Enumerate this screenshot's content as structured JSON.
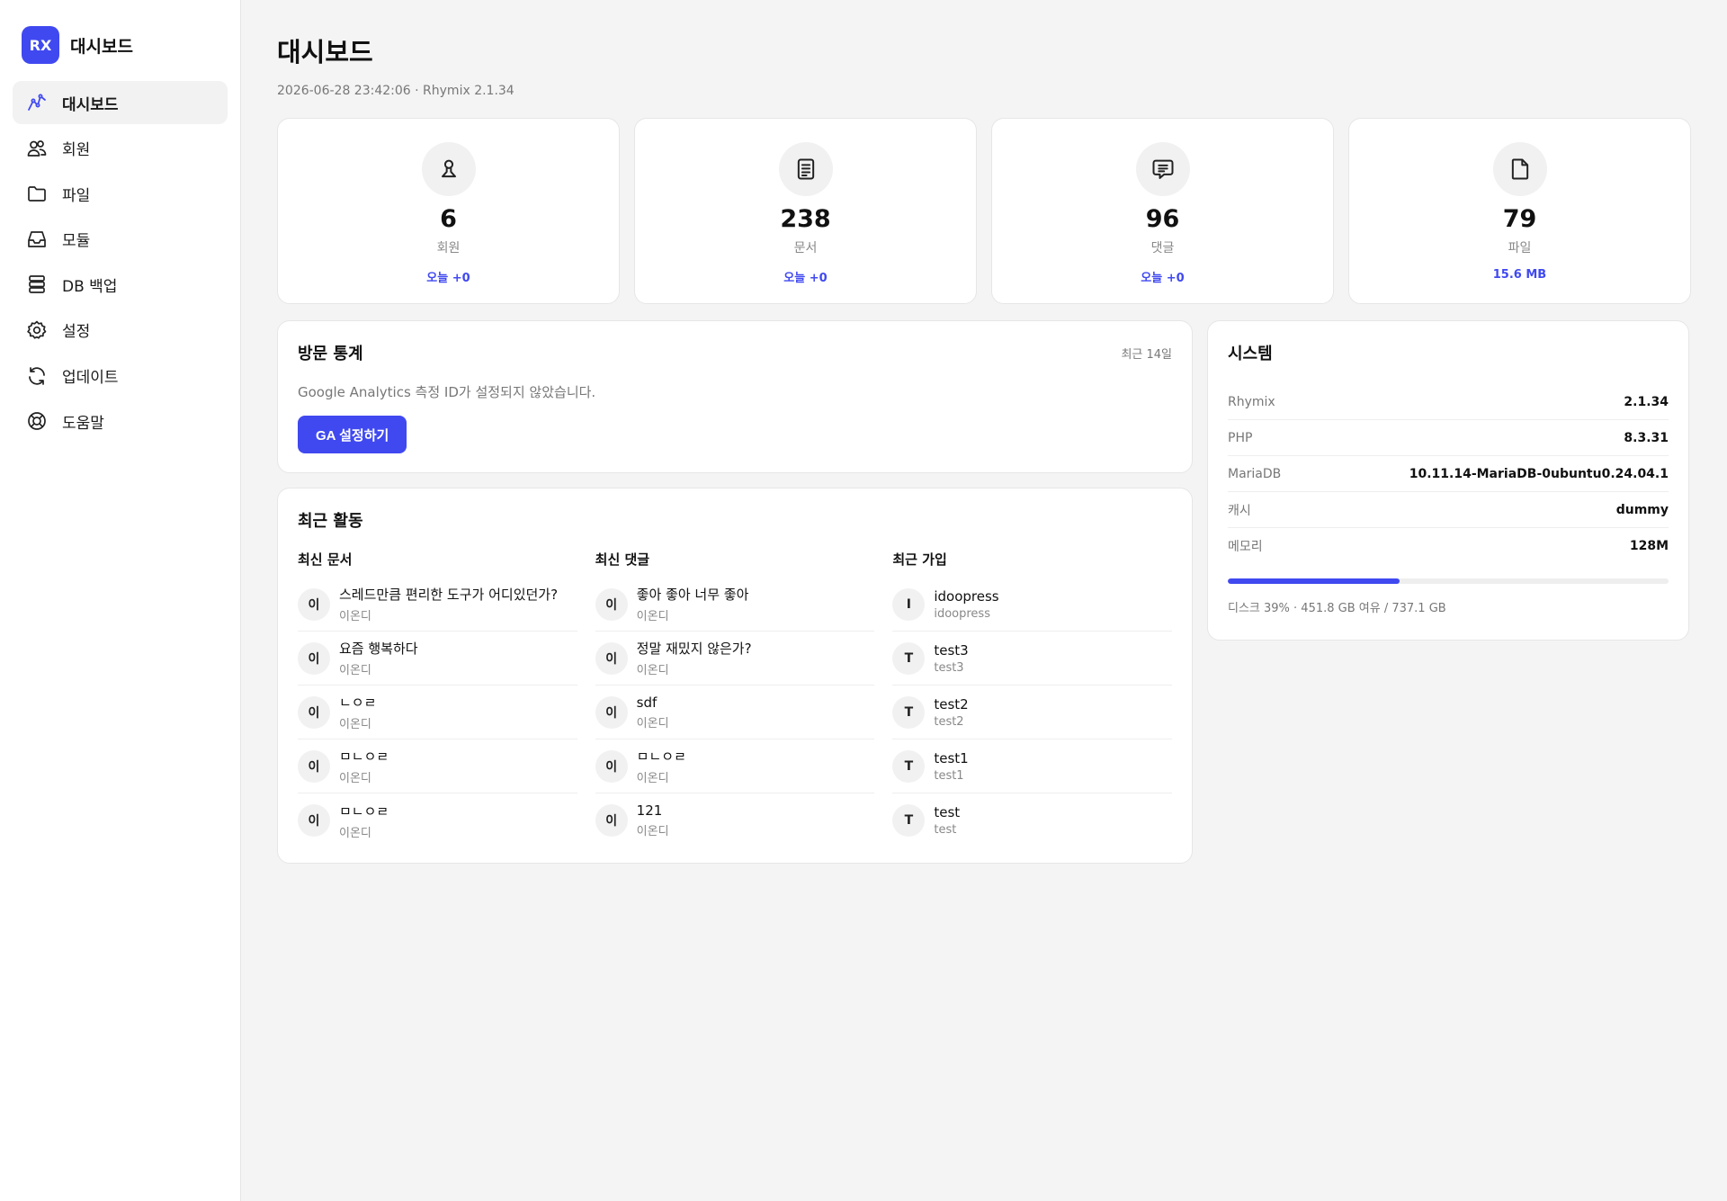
{
  "brand": {
    "logo_text": "RX",
    "name": "대시보드"
  },
  "sidebar": {
    "items": [
      {
        "label": "대시보드",
        "icon": "chart-line-icon",
        "active": true
      },
      {
        "label": "회원",
        "icon": "users-icon",
        "active": false
      },
      {
        "label": "파일",
        "icon": "folder-icon",
        "active": false
      },
      {
        "label": "모듈",
        "icon": "inbox-icon",
        "active": false
      },
      {
        "label": "DB 백업",
        "icon": "database-icon",
        "active": false
      },
      {
        "label": "설정",
        "icon": "gear-icon",
        "active": false
      },
      {
        "label": "업데이트",
        "icon": "refresh-icon",
        "active": false
      },
      {
        "label": "도움말",
        "icon": "lifebuoy-icon",
        "active": false
      }
    ]
  },
  "header": {
    "title": "대시보드",
    "subtitle": "2026-06-28 23:42:06 · Rhymix 2.1.34"
  },
  "stats": [
    {
      "value": "6",
      "label": "회원",
      "delta": "오늘 +0",
      "icon": "user-icon"
    },
    {
      "value": "238",
      "label": "문서",
      "delta": "오늘 +0",
      "icon": "document-icon"
    },
    {
      "value": "96",
      "label": "댓글",
      "delta": "오늘 +0",
      "icon": "comment-icon"
    },
    {
      "value": "79",
      "label": "파일",
      "delta": "15.6 MB",
      "icon": "file-icon"
    }
  ],
  "visits": {
    "title": "방문 통계",
    "meta": "최근 14일",
    "message": "Google Analytics 측정 ID가 설정되지 않았습니다.",
    "button": "GA 설정하기"
  },
  "activity": {
    "title": "최근 활동",
    "columns": [
      {
        "title": "최신 문서",
        "items": [
          {
            "avatar": "이",
            "title": "스레드만큼 편리한 도구가 어디있던가?",
            "author": "이온디"
          },
          {
            "avatar": "이",
            "title": "요즘 행복하다",
            "author": "이온디"
          },
          {
            "avatar": "이",
            "title": "ㄴㅇㄹ",
            "author": "이온디"
          },
          {
            "avatar": "이",
            "title": "ㅁㄴㅇㄹ",
            "author": "이온디"
          },
          {
            "avatar": "이",
            "title": "ㅁㄴㅇㄹ",
            "author": "이온디"
          }
        ]
      },
      {
        "title": "최신 댓글",
        "items": [
          {
            "avatar": "이",
            "title": "좋아 좋아 너무 좋아",
            "author": "이온디"
          },
          {
            "avatar": "이",
            "title": "정말 재밌지 않은가?",
            "author": "이온디"
          },
          {
            "avatar": "이",
            "title": "sdf",
            "author": "이온디"
          },
          {
            "avatar": "이",
            "title": "ㅁㄴㅇㄹ",
            "author": "이온디"
          },
          {
            "avatar": "이",
            "title": "121",
            "author": "이온디"
          }
        ]
      },
      {
        "title": "최근 가입",
        "items": [
          {
            "avatar": "I",
            "title": "idoopress",
            "author": "idoopress"
          },
          {
            "avatar": "T",
            "title": "test3",
            "author": "test3"
          },
          {
            "avatar": "T",
            "title": "test2",
            "author": "test2"
          },
          {
            "avatar": "T",
            "title": "test1",
            "author": "test1"
          },
          {
            "avatar": "T",
            "title": "test",
            "author": "test"
          }
        ]
      }
    ]
  },
  "system": {
    "title": "시스템",
    "rows": [
      {
        "key": "Rhymix",
        "value": "2.1.34"
      },
      {
        "key": "PHP",
        "value": "8.3.31"
      },
      {
        "key": "MariaDB",
        "value": "10.11.14-MariaDB-0ubuntu0.24.04.1"
      },
      {
        "key": "캐시",
        "value": "dummy"
      },
      {
        "key": "메모리",
        "value": "128M"
      }
    ],
    "disk_percent": 39,
    "disk_text": "디스크 39% · 451.8 GB 여유 / 737.1 GB"
  },
  "colors": {
    "accent": "#4049f0",
    "background": "#f4f4f4"
  }
}
